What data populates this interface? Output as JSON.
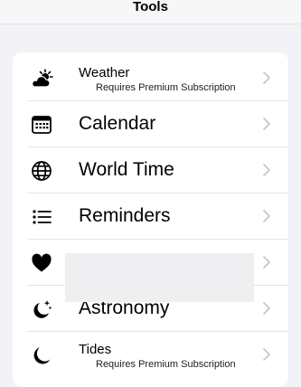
{
  "nav": {
    "title": "Tools"
  },
  "colors": {
    "background": "#f2f2f7",
    "card": "#ffffff",
    "chevron": "#c4c4c8",
    "separator": "#e3e3e8"
  },
  "items": [
    {
      "label": "Weather",
      "subtitle": "Requires Premium Subscription",
      "icon": "weather-icon"
    },
    {
      "label": "Calendar",
      "icon": "calendar-icon"
    },
    {
      "label": "World Time",
      "icon": "globe-icon"
    },
    {
      "label": "Reminders",
      "icon": "list-icon"
    },
    {
      "label": "",
      "icon": "heart-icon"
    },
    {
      "label": "Astronomy",
      "icon": "moon-stars-icon"
    },
    {
      "label": "Tides",
      "subtitle": "Requires Premium Subscription",
      "icon": "moon-icon"
    }
  ]
}
